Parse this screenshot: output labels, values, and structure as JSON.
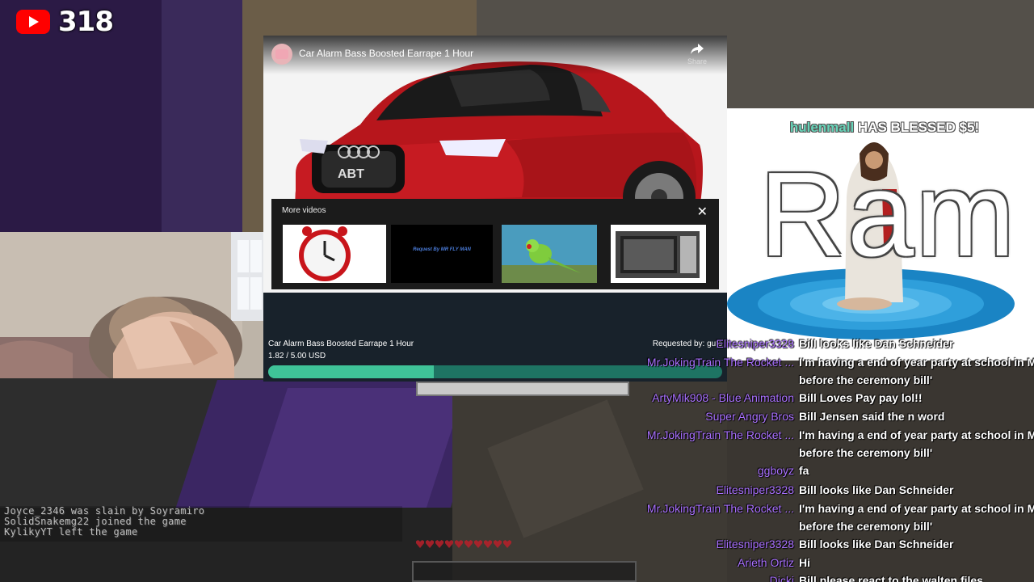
{
  "viewer_badge": {
    "count": "318",
    "icon": "youtube-icon"
  },
  "video": {
    "title": "Car Alarm Bass Boosted Earrape 1 Hour",
    "share_label": "Share",
    "more_videos_label": "More videos",
    "thumbnails": [
      "clock",
      "Request By MR FLY MAN",
      "parrot",
      "microwave"
    ]
  },
  "media_request": {
    "title": "Car Alarm Bass Boosted Earrape 1 Hour",
    "amount": "1.82 / 5.00 USD",
    "requested_by": "Requested by: guts",
    "progress": 0.364,
    "colors": {
      "fill": "#3fc398",
      "track": "#1e7463"
    }
  },
  "alert": {
    "user": "hulenmall",
    "text": " HAS BLESSED $5!",
    "big_text": "Ram"
  },
  "chat": [
    {
      "user": "Elitesniper3328",
      "text": "Bill looks like Dan Schneider",
      "color": "#a970ff"
    },
    {
      "user": "Mr.JokingTrain The Rocket ...",
      "text": "I'm having a end of year party at school in Ma",
      "color": "#a970ff"
    },
    {
      "user": "",
      "text": "before the ceremony bill'",
      "color": "#a970ff"
    },
    {
      "user": "ArtyMik908 - Blue Animation",
      "text": "Bill Loves Pay pay lol!!",
      "color": "#a970ff"
    },
    {
      "user": "Super Angry Bros",
      "text": "Bill Jensen said the n word",
      "color": "#a970ff"
    },
    {
      "user": "Mr.JokingTrain The Rocket ...",
      "text": "I'm having a end of year party at school in Ma",
      "color": "#a970ff"
    },
    {
      "user": "",
      "text": "before the ceremony bill'",
      "color": "#a970ff"
    },
    {
      "user": "ggboyz",
      "text": "fa",
      "color": "#a970ff"
    },
    {
      "user": "Elitesniper3328",
      "text": "Bill looks like Dan Schneider",
      "color": "#a970ff"
    },
    {
      "user": "Mr.JokingTrain The Rocket ...",
      "text": "I'm having a end of year party at school in Ma",
      "color": "#a970ff"
    },
    {
      "user": "",
      "text": "before the ceremony bill'",
      "color": "#a970ff"
    },
    {
      "user": "Elitesniper3328",
      "text": "Bill looks like Dan Schneider",
      "color": "#a970ff"
    },
    {
      "user": "Arieth Ortiz",
      "text": "Hi",
      "color": "#a970ff"
    },
    {
      "user": "Dicki",
      "text": "Bill please react to the walten files",
      "color": "#a970ff"
    }
  ],
  "game_chat": [
    "Joyce_2346 was slain by Soyramiro",
    "SolidSnakemg22 joined the game",
    "KylikyYT left the game"
  ]
}
